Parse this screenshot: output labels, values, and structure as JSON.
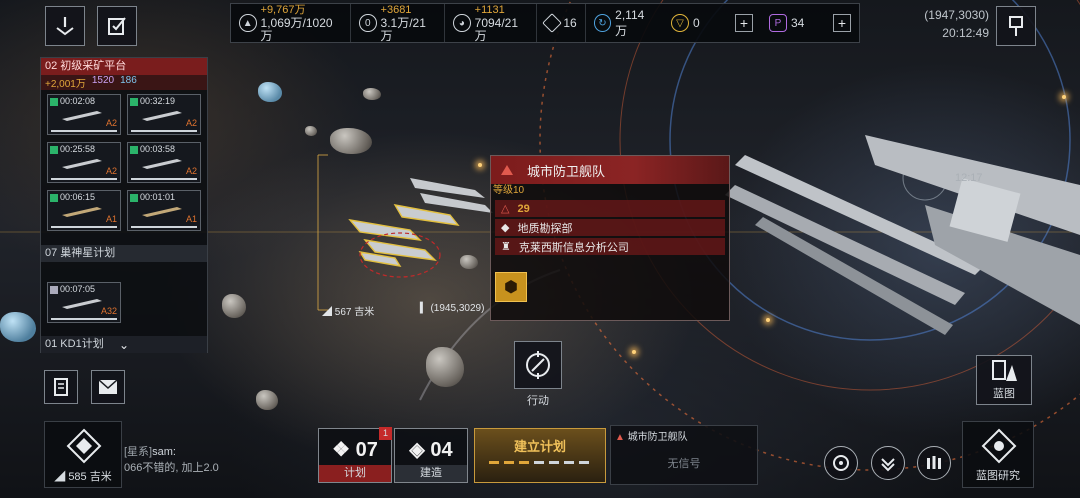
{
  "top_left": {
    "alert_button": "alert-icon",
    "tasks_button": "checklist-icon"
  },
  "resources": [
    {
      "icon": "metal-icon",
      "gain": "+9,767万",
      "value": "1,069万/1020万"
    },
    {
      "icon": "crystal-icon",
      "gain": "+3681",
      "value": "3.1万/21万"
    },
    {
      "icon": "gas-icon",
      "gain": "+1131",
      "value": "7094/21万"
    }
  ],
  "fleet_count": "16",
  "credits": "2,114万",
  "currency_gold": "0",
  "currency_purple": "34",
  "coords_top": "(1947,3030)",
  "clock": "20:12:49",
  "left_panel": {
    "section1_title": "02 初级采矿平台",
    "section1_stats": [
      "+2,001万",
      "1520",
      "186"
    ],
    "cards": [
      {
        "time": "00:02:08",
        "level": "A2"
      },
      {
        "time": "00:32:19",
        "level": "A2"
      },
      {
        "time": "00:25:58",
        "level": "A2"
      },
      {
        "time": "00:03:58",
        "level": "A2"
      },
      {
        "time": "00:06:15",
        "level": "A1"
      },
      {
        "time": "00:01:01",
        "level": "A1"
      }
    ],
    "section2_title": "07 巢神星计划",
    "card2": {
      "time": "00:07:05",
      "level": "A32"
    },
    "section3_title": "01 KD1计划"
  },
  "map": {
    "distance_label": "567 吉米",
    "target_coord": "(1945,3029)",
    "timer_label": "12:17"
  },
  "info_panel": {
    "title": "城市防卫舰队",
    "level": "等级10",
    "power": "29",
    "faction": "地质勘探部",
    "company": "克莱西斯信息分析公司"
  },
  "action_label": "行动",
  "blueprint_label": "蓝图",
  "bottom": {
    "galaxy_distance": "585 吉米",
    "chat_channel": "[星系]",
    "chat_user": "sam:",
    "chat_msg": "066不错的, 加上2.0",
    "plan_count": "07",
    "plan_label": "计划",
    "plan_badge": "1",
    "build_count": "04",
    "build_label": "建造",
    "establish_label": "建立计划",
    "target_name": "城市防卫舰队",
    "no_signal": "无信号",
    "research_label": "蓝图研究"
  }
}
